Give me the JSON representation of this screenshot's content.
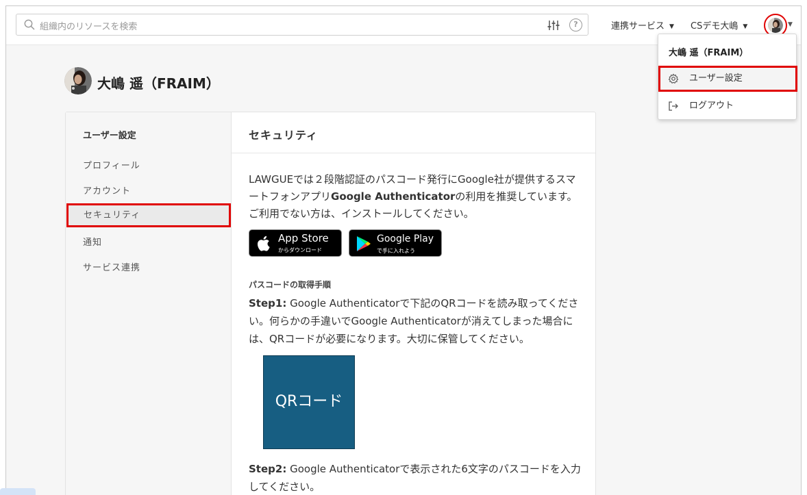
{
  "search": {
    "placeholder": "組織内のリソースを検索"
  },
  "header": {
    "integrations_label": "連携サービス",
    "org_label": "CSデモ大嶋"
  },
  "user": {
    "name": "大嶋 遥（FRAIM）"
  },
  "sidebar": {
    "title": "ユーザー設定",
    "items": [
      {
        "label": "プロフィール"
      },
      {
        "label": "アカウント"
      },
      {
        "label": "セキュリティ"
      },
      {
        "label": "通知"
      },
      {
        "label": "サービス連携"
      }
    ]
  },
  "content": {
    "title": "セキュリティ",
    "intro_1": "LAWGUEでは２段階認証のパスコード発行にGoogle社が提供するスマートフォンアプリ",
    "intro_bold": "Google Authenticator",
    "intro_2": "の利用を推奨しています。ご利用でない方は、インストールしてください。",
    "app_store": {
      "line1": "App Store",
      "line2": "からダウンロード"
    },
    "google_play": {
      "line1": "Google Play",
      "line2": "で手に入れよう"
    },
    "subheading": "パスコードの取得手順",
    "step1_label": "Step1:",
    "step1_text": " Google Authenticatorで下記のQRコードを読み取ってください。何らかの手違いでGoogle Authenticatorが消えてしまった場合には、QRコードが必要になります。大切に保管してください。",
    "qr_label": "QRコード",
    "step2_label": "Step2:",
    "step2_text": " Google Authenticatorで表示された6文字のパスコードを入力してください。"
  },
  "dropdown": {
    "name": "大嶋 遥（FRAIM）",
    "items": [
      {
        "label": "ユーザー設定",
        "icon": "gear-icon"
      },
      {
        "label": "ログアウト",
        "icon": "logout-icon"
      }
    ]
  },
  "colors": {
    "highlight": "#e00000",
    "qr_bg": "#175e82"
  }
}
